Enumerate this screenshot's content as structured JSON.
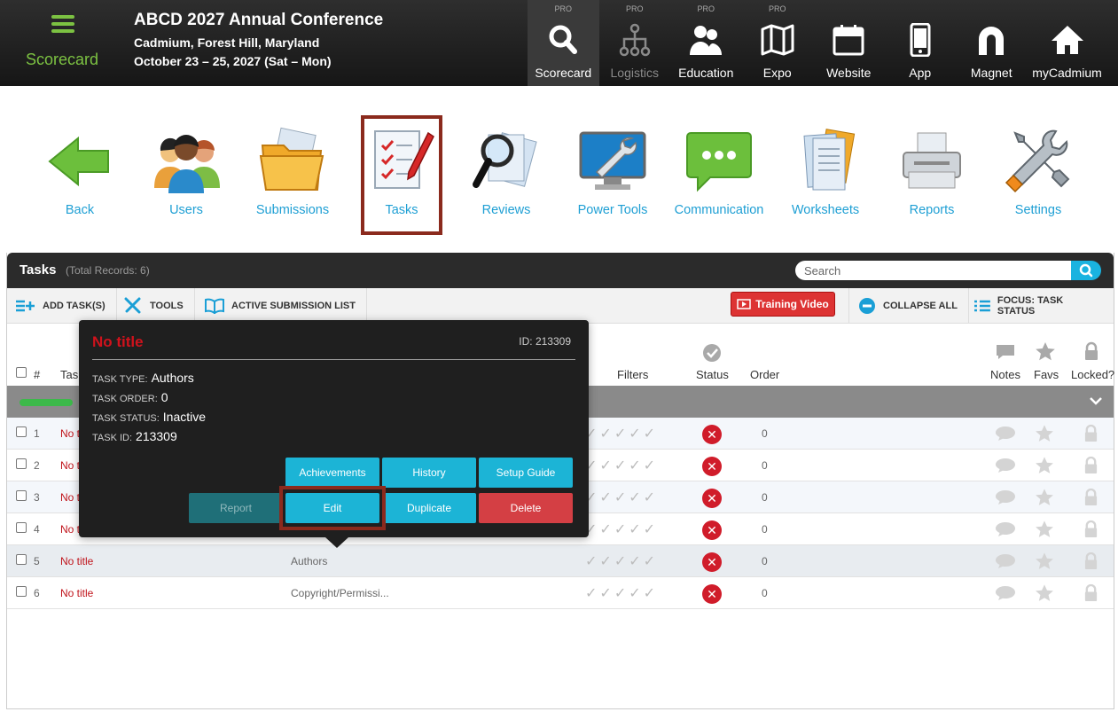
{
  "header": {
    "app_name": "Scorecard",
    "conference_title": "ABCD 2027 Annual Conference",
    "location": "Cadmium, Forest Hill, Maryland",
    "dates": "October 23 – 25, 2027 (Sat – Mon)"
  },
  "modules": [
    {
      "pro": "PRO",
      "label": "Scorecard",
      "icon": "search-icon"
    },
    {
      "pro": "PRO",
      "label": "Logistics",
      "icon": "network-icon"
    },
    {
      "pro": "PRO",
      "label": "Education",
      "icon": "people-icon"
    },
    {
      "pro": "PRO",
      "label": "Expo",
      "icon": "map-icon"
    },
    {
      "pro": "",
      "label": "Website",
      "icon": "calendar-icon"
    },
    {
      "pro": "",
      "label": "App",
      "icon": "phone-icon"
    },
    {
      "pro": "",
      "label": "Magnet",
      "icon": "magnet-icon"
    },
    {
      "pro": "",
      "label": "myCadmium",
      "icon": "home-icon"
    }
  ],
  "nav": [
    {
      "label": "Back",
      "icon": "back-arrow-icon"
    },
    {
      "label": "Users",
      "icon": "users-icon"
    },
    {
      "label": "Submissions",
      "icon": "folder-icon"
    },
    {
      "label": "Tasks",
      "icon": "tasks-checklist-icon"
    },
    {
      "label": "Reviews",
      "icon": "magnifier-icon"
    },
    {
      "label": "Power Tools",
      "icon": "wrench-monitor-icon"
    },
    {
      "label": "Communication",
      "icon": "chat-bubble-icon"
    },
    {
      "label": "Worksheets",
      "icon": "documents-icon"
    },
    {
      "label": "Reports",
      "icon": "printer-icon"
    },
    {
      "label": "Settings",
      "icon": "tools-icon"
    }
  ],
  "panel": {
    "title": "Tasks",
    "record_count": "(Total Records: 6)",
    "search_placeholder": "Search"
  },
  "toolbar": {
    "add_tasks": "ADD TASK(S)",
    "tools": "TOOLS",
    "active_list": "ACTIVE SUBMISSION LIST",
    "training_video": "Training Video",
    "collapse_all": "COLLAPSE ALL",
    "focus": "FOCUS: TASK STATUS"
  },
  "columns": {
    "num": "#",
    "task": "Tas",
    "filters": "Filters",
    "status": "Status",
    "order": "Order",
    "notes": "Notes",
    "favs": "Favs",
    "locked": "Locked?"
  },
  "rows": [
    {
      "num": "1",
      "title": "No tit",
      "type": "",
      "checks": "✓✓✓✓✓",
      "status": "✕",
      "order": "0"
    },
    {
      "num": "2",
      "title": "No tit",
      "type": "",
      "checks": "✓✓✓✓✓",
      "status": "✕",
      "order": "0"
    },
    {
      "num": "3",
      "title": "No tit",
      "type": "",
      "checks": "✓✓✓✓✓",
      "status": "✕",
      "order": "0"
    },
    {
      "num": "4",
      "title": "No tit",
      "type": "",
      "checks": "✓✓✓✓✓",
      "status": "✕",
      "order": "0"
    },
    {
      "num": "5",
      "title": "No title",
      "type": "Authors",
      "checks": "✓✓✓✓✓",
      "status": "✕",
      "order": "0"
    },
    {
      "num": "6",
      "title": "No title",
      "type": "Copyright/Permissi...",
      "checks": "✓✓✓✓✓",
      "status": "✕",
      "order": "0"
    }
  ],
  "popup": {
    "title": "No title",
    "id_label": "ID: 213309",
    "task_type_label": "TASK TYPE:",
    "task_type": "Authors",
    "task_order_label": "TASK ORDER:",
    "task_order": "0",
    "task_status_label": "TASK STATUS:",
    "task_status": "Inactive",
    "task_id_label": "TASK ID:",
    "task_id": "213309",
    "btn_achievements": "Achievements",
    "btn_history": "History",
    "btn_setup": "Setup Guide",
    "btn_report": "Report",
    "btn_edit": "Edit",
    "btn_duplicate": "Duplicate",
    "btn_delete": "Delete"
  }
}
